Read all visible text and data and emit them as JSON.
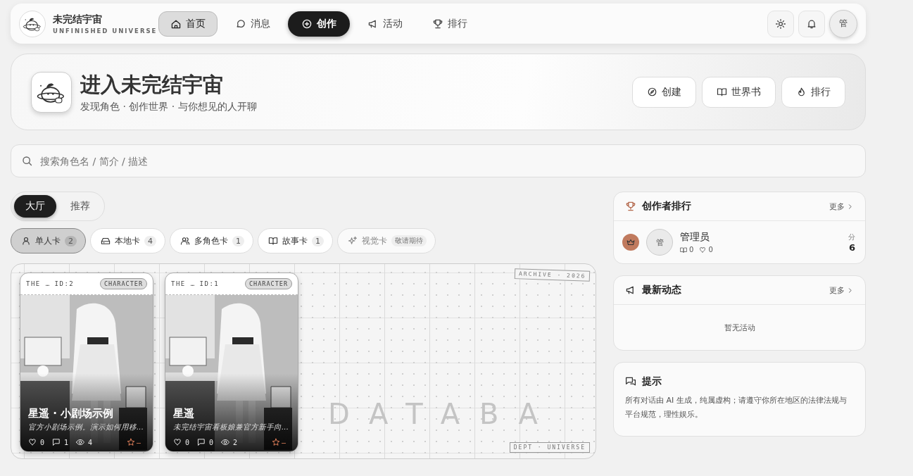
{
  "brand": {
    "name": "未完结宇宙",
    "tagline": "UNFINISHED UNIVERSE"
  },
  "nav": [
    {
      "label": "首页",
      "selected": true,
      "kind": "tab"
    },
    {
      "label": "消息",
      "selected": false,
      "kind": "tab"
    },
    {
      "label": "创作",
      "selected": false,
      "kind": "primary"
    },
    {
      "label": "活动",
      "selected": false,
      "kind": "tab"
    },
    {
      "label": "排行",
      "selected": false,
      "kind": "tab"
    }
  ],
  "user": {
    "avatar": "管"
  },
  "hero": {
    "title": "进入未完结宇宙",
    "subtitle": "发现角色 · 创作世界 · 与你想见的人开聊",
    "buttons": [
      "创建",
      "世界书",
      "排行"
    ]
  },
  "search": {
    "placeholder": "搜索角色名 / 简介 / 描述"
  },
  "view_tabs": [
    {
      "label": "大厅",
      "selected": true
    },
    {
      "label": "推荐",
      "selected": false
    }
  ],
  "filters": [
    {
      "label": "单人卡",
      "count": "2",
      "selected": true,
      "disabled": false
    },
    {
      "label": "本地卡",
      "count": "4",
      "selected": false,
      "disabled": false
    },
    {
      "label": "多角色卡",
      "count": "1",
      "selected": false,
      "disabled": false
    },
    {
      "label": "故事卡",
      "count": "1",
      "selected": false,
      "disabled": false
    },
    {
      "label": "视觉卡",
      "count": "敬请期待",
      "selected": false,
      "disabled": true
    }
  ],
  "board": {
    "watermark": "DATABA",
    "stamp_top": "ARCHIVE · 2026",
    "stamp_bottom": "DEPT · UNIVERSE"
  },
  "cards": [
    {
      "series": "THE …",
      "id": "ID:2",
      "tag": "CHARACTER",
      "kind": "picture",
      "title": "星遥 · 小剧场示例",
      "description": "官方小剧场示例。演示如何用移...",
      "likes": "0",
      "comments": "1",
      "views": "4",
      "rating": "–"
    },
    {
      "series": "THE …",
      "id": "ID:1",
      "tag": "CHARACTER",
      "kind": "picture",
      "title": "星遥",
      "description": "未完结宇宙看板娘兼官方新手向...",
      "likes": "0",
      "comments": "0",
      "views": "2",
      "rating": "–"
    }
  ],
  "ranking": {
    "title": "创作者排行",
    "more": "更多",
    "rows": [
      {
        "color": "#c07a5e",
        "avatar": "管",
        "name": "管理员",
        "works": "0",
        "likes": "0",
        "score_label": "分",
        "score": "6"
      }
    ]
  },
  "activity": {
    "title": "最新动态",
    "more": "更多",
    "empty": "暂无活动"
  },
  "notice": {
    "title": "提示",
    "text": "所有对话由 AI 生成，纯属虚构；请遵守你所在地区的法律法规与平台规范，理性娱乐。"
  }
}
